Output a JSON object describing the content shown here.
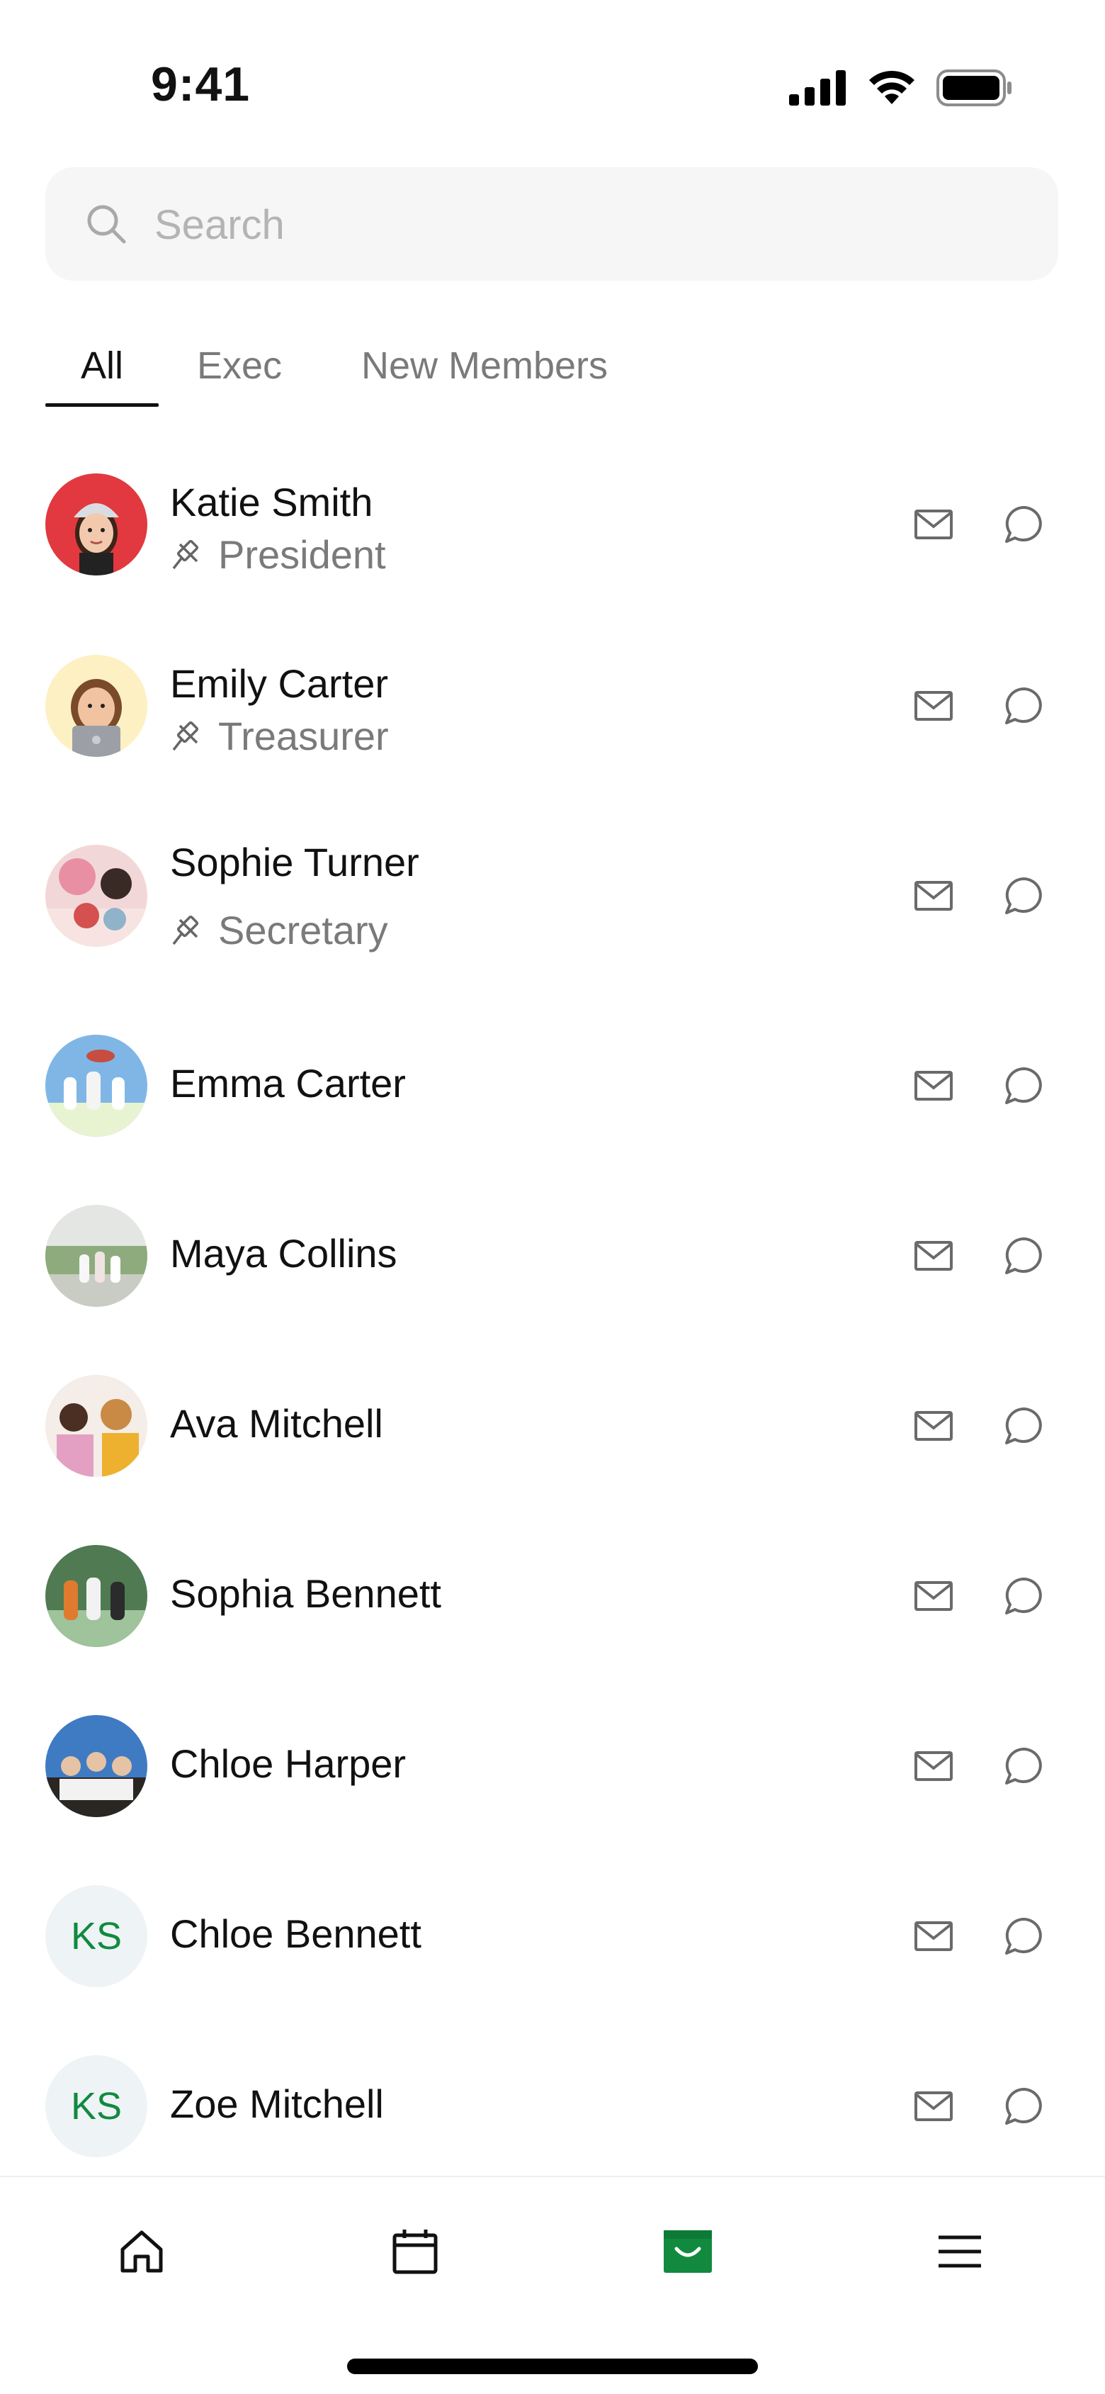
{
  "status_bar": {
    "time": "9:41",
    "icons": [
      "signal-icon",
      "wifi-icon",
      "battery-icon"
    ]
  },
  "search": {
    "placeholder": "Search",
    "value": "",
    "icon": "search-icon"
  },
  "tabs": [
    {
      "label": "All",
      "active": true
    },
    {
      "label": "Exec",
      "active": false
    },
    {
      "label": "New Members",
      "active": false
    }
  ],
  "members": [
    {
      "name": "Katie Smith",
      "role": "President",
      "role_icon": "gavel-icon",
      "avatar": "memoji-red"
    },
    {
      "name": "Emily Carter",
      "role": "Treasurer",
      "role_icon": "gavel-icon",
      "avatar": "memoji-yellow"
    },
    {
      "name": "Sophie Turner",
      "role": "Secretary",
      "role_icon": "gavel-icon",
      "avatar": "photo"
    },
    {
      "name": "Emma Carter",
      "role": "",
      "avatar": "photo"
    },
    {
      "name": "Maya Collins",
      "role": "",
      "avatar": "photo"
    },
    {
      "name": "Ava Mitchell",
      "role": "",
      "avatar": "photo"
    },
    {
      "name": "Sophia Bennett",
      "role": "",
      "avatar": "photo"
    },
    {
      "name": "Chloe Harper",
      "role": "",
      "avatar": "photo"
    },
    {
      "name": "Chloe Bennett",
      "role": "",
      "avatar": "initials",
      "initials": "KS"
    },
    {
      "name": "Zoe Mitchell",
      "role": "",
      "avatar": "initials",
      "initials": "KS"
    }
  ],
  "row_actions": [
    "mail-icon",
    "chat-bubble-icon"
  ],
  "bottom_nav": [
    {
      "icon": "home-icon",
      "active": false
    },
    {
      "icon": "calendar-icon",
      "active": false
    },
    {
      "icon": "inbox-icon",
      "active": true
    },
    {
      "icon": "menu-icon",
      "active": false
    }
  ],
  "colors": {
    "accent_green": "#118a3f",
    "initials_bg": "#eef3f6",
    "search_bg": "#f6f6f6",
    "secondary_text": "#7a7a7a"
  }
}
